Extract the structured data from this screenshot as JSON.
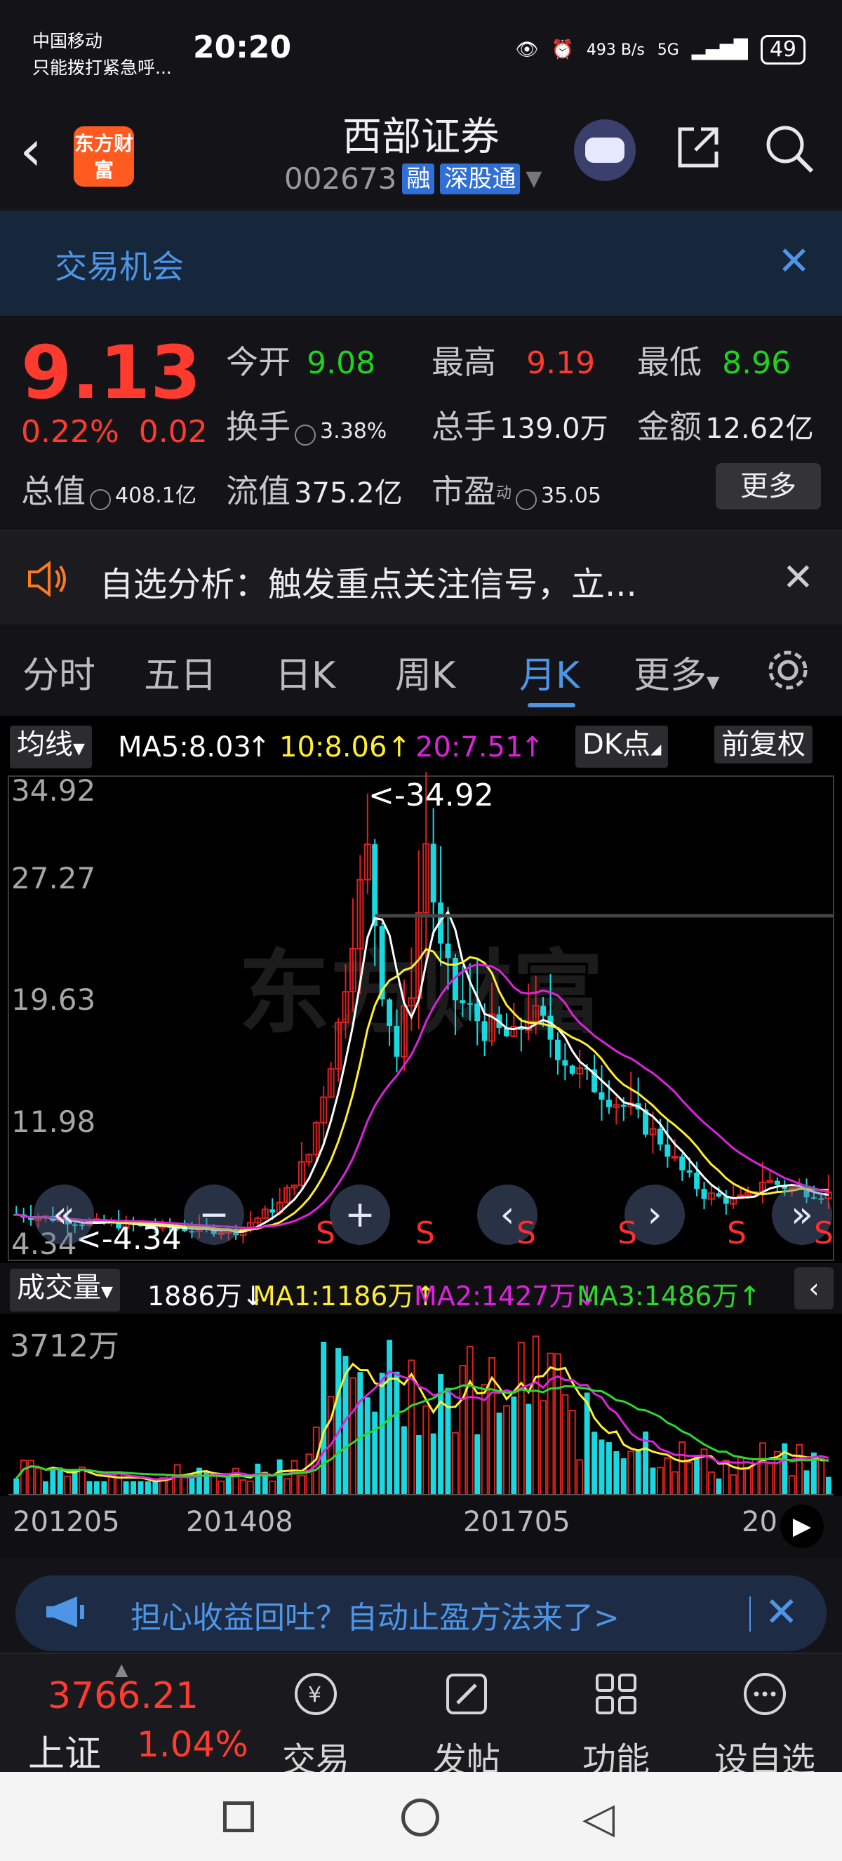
{
  "status_bar": {
    "carrier": "中国移动",
    "emergency": "只能拨打紧急呼...",
    "time": "20:20",
    "net_speed": "493 B/s",
    "network": "5G",
    "battery": "49"
  },
  "header": {
    "back_icon": "back-arrow-icon",
    "logo_text": "东方财富",
    "stock_name": "西部证券",
    "stock_code": "002673",
    "tag_margin": "融",
    "tag_connect": "深股通",
    "share_icon": "share-icon",
    "search_icon": "search-icon"
  },
  "banner": {
    "text": "交易机会"
  },
  "quote": {
    "price": "9.13",
    "change_pct": "0.22%",
    "change_abs": "0.02",
    "rows": [
      [
        {
          "label": "今开",
          "value": "9.08",
          "color": "green"
        },
        {
          "label": "最高",
          "value": "9.19",
          "color": "red"
        },
        {
          "label": "最低",
          "value": "8.96",
          "color": "green"
        }
      ],
      [
        {
          "label": "换手",
          "value": "3.38%",
          "color": "white"
        },
        {
          "label": "总手",
          "value": "139.0万",
          "color": "white"
        },
        {
          "label": "金额",
          "value": "12.62亿",
          "color": "white"
        }
      ]
    ],
    "total_value_label": "总值",
    "total_value": "408.1亿",
    "float_value_label": "流值",
    "float_value": "375.2亿",
    "pe_label": "市盈",
    "pe_sup": "动",
    "pe_value": "35.05",
    "more_button": "更多"
  },
  "alert": {
    "text": "自选分析：触发重点关注信号，立..."
  },
  "tabs": {
    "items": [
      "分时",
      "五日",
      "日K",
      "周K",
      "月K",
      "更多"
    ],
    "active": "月K"
  },
  "kline": {
    "ma_type": "均线",
    "ma5": "MA5:8.03",
    "ma10": "10:8.06",
    "ma20": "20:7.51",
    "dk": "DK点",
    "adjust": "前复权",
    "y_ticks": [
      "34.92",
      "27.27",
      "19.63",
      "11.98",
      "4.34"
    ],
    "max_label": "<-34.92",
    "min_label": "<-4.34",
    "signal_label": "S",
    "watermark": "东方财富"
  },
  "volume": {
    "label": "成交量",
    "current": "1886万",
    "ma1": "MA1:1186万",
    "ma2": "MA2:1427万",
    "ma3": "MA3:1486万",
    "max_label": "3712万",
    "x_ticks": [
      "201205",
      "201408",
      "201705",
      "20"
    ]
  },
  "ad": {
    "text": "担心收益回吐？自动止盈方法来了>"
  },
  "bottom": {
    "index_value": "3766.21",
    "index_name": "上证",
    "index_pct": "1.04%",
    "nav": [
      {
        "label": "交易",
        "icon": "trade-icon"
      },
      {
        "label": "发帖",
        "icon": "post-icon"
      },
      {
        "label": "功能",
        "icon": "grid-icon"
      },
      {
        "label": "设自选",
        "icon": "more-dots-icon"
      }
    ]
  },
  "colors": {
    "up": "#ff3b30",
    "down": "#1fd21f",
    "accent": "#4e95e6",
    "ma5": "#ffffff",
    "ma10": "#ffee33",
    "ma20": "#dd22dd",
    "candle_up": "#e0201e",
    "candle_down": "#19d8df"
  }
}
